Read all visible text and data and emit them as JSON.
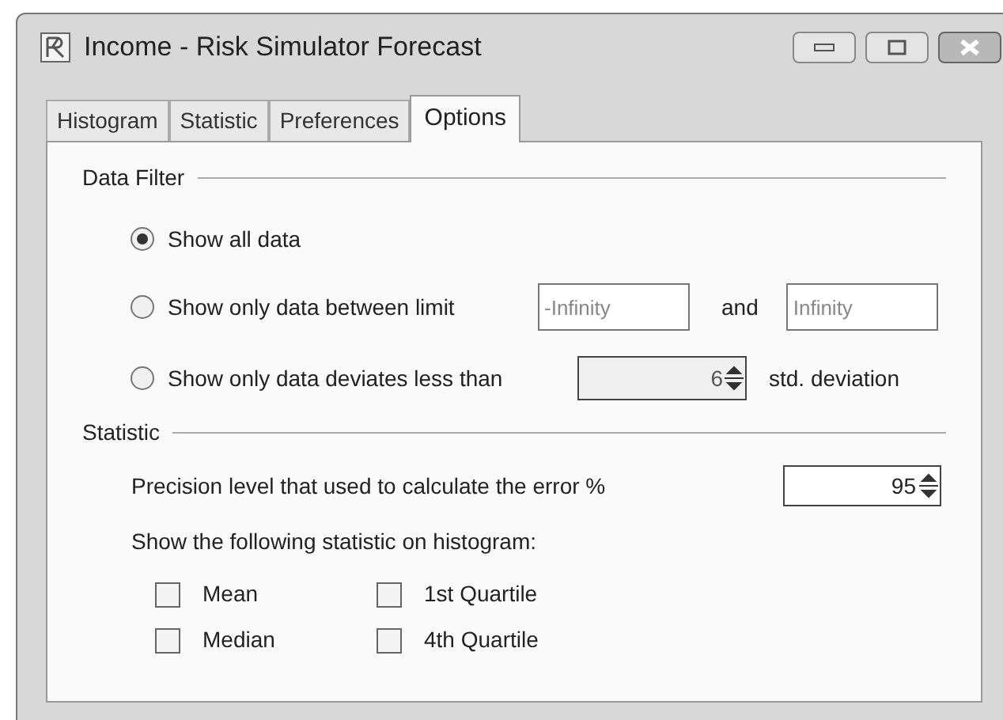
{
  "window": {
    "title": "Income - Risk Simulator Forecast"
  },
  "tabs": [
    {
      "label": "Histogram",
      "selected": false
    },
    {
      "label": "Statistic",
      "selected": false
    },
    {
      "label": "Preferences",
      "selected": false
    },
    {
      "label": "Options",
      "selected": true
    }
  ],
  "data_filter": {
    "heading": "Data Filter",
    "options": [
      {
        "kind": "plain",
        "label": "Show all data",
        "selected": true
      },
      {
        "kind": "range",
        "label": "Show only data between limit",
        "low": "-Infinity",
        "joiner": "and",
        "high": "Infinity",
        "selected": false
      },
      {
        "kind": "spin",
        "label": "Show only data deviates less than",
        "value": "6",
        "suffix": "std. deviation",
        "selected": false
      }
    ]
  },
  "statistic": {
    "heading": "Statistic",
    "precision_label": "Precision level that used to calculate the error %",
    "precision_value": "95",
    "show_label": "Show the following statistic on histogram:",
    "checkboxes": [
      {
        "label": "Mean",
        "checked": false
      },
      {
        "label": "1st Quartile",
        "checked": false
      },
      {
        "label": "Median",
        "checked": false
      },
      {
        "label": "4th Quartile",
        "checked": false
      }
    ]
  }
}
